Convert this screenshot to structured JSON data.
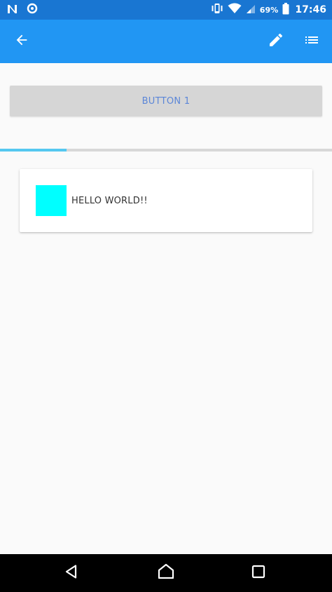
{
  "status_bar": {
    "battery_percent": "69%",
    "time": "17:46",
    "icons": [
      "notification-n-icon",
      "settings-notification-icon",
      "vibrate-icon",
      "wifi-icon",
      "signal-icon",
      "battery-icon"
    ]
  },
  "app_bar": {
    "icons": [
      "back-arrow-icon",
      "edit-pencil-icon",
      "list-icon"
    ]
  },
  "content": {
    "button_1_label": "BUTTON 1",
    "progress_fraction": 0.2,
    "card_text": "HELLO WORLD!!"
  },
  "nav_bar": {
    "icons": [
      "nav-back-icon",
      "nav-home-icon",
      "nav-recents-icon"
    ]
  },
  "colors": {
    "status_bar": "#1976d2",
    "app_bar": "#2196f3",
    "background": "#fafafa",
    "button_bg": "#d6d6d6",
    "button_text": "#5b86d8",
    "progress_track": "#d8d8d8",
    "progress_fill": "#55c8f0",
    "card_swatch": "#00ffff"
  }
}
